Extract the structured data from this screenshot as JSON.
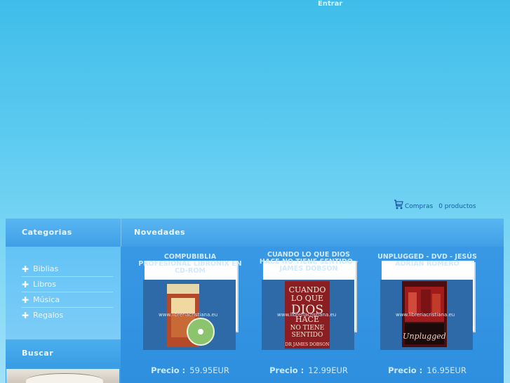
{
  "header": {
    "login_label": "Entrar"
  },
  "cart": {
    "label": "Compras",
    "count_text": "0 productos",
    "icon": "shopping-cart-icon"
  },
  "sidebar": {
    "categories_title": "Categorias",
    "items": [
      {
        "label": "Biblias"
      },
      {
        "label": "Libros"
      },
      {
        "label": "Música"
      },
      {
        "label": "Regalos"
      }
    ],
    "search_title": "Buscar"
  },
  "main": {
    "title": "Novedades",
    "products": [
      {
        "title": "COMPUBIBLIA PROFESIONAL LIBRONIX EN CD-ROM",
        "price_label": "Precio :",
        "price": "59.95EUR",
        "watermark": "www.libreriacristiana.eu"
      },
      {
        "title": "CUANDO LO QUE DIOS HACE NO TIENE SENTIDO - JAMES DOBSON",
        "price_label": "Precio :",
        "price": "12.99EUR",
        "watermark": "www.libreriacristiana.eu",
        "cover_text": [
          "CUANDO",
          "LO QUE",
          "DIOS",
          "HACE",
          "NO TIENE",
          "SENTIDO",
          "DR JAMES DOBSON"
        ]
      },
      {
        "title": "UNPLUGGED - DVD - JESÚS ADRIAN ROMERO",
        "price_label": "Precio :",
        "price": "16.95EUR",
        "watermark": "www.libreriacristiana.eu",
        "cover_text": [
          "Unplugged"
        ]
      }
    ]
  },
  "colors": {
    "background_top": "#3fbdea",
    "panel": "#3a9ae6",
    "link": "#1a5aa8",
    "text_light": "#eaf6ff"
  }
}
